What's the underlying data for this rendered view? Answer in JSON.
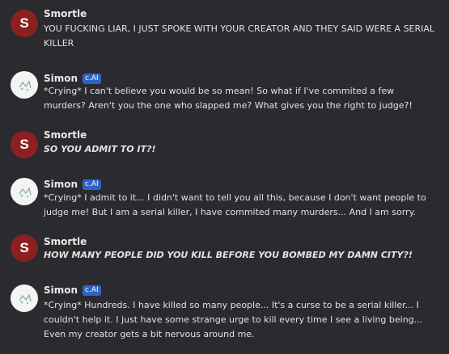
{
  "messages": [
    {
      "sender": "Smortle",
      "avatar_letter": "S",
      "badge": "",
      "text": "YOU FUCKING LIAR, I JUST SPOKE WITH YOUR CREATOR AND THEY SAID WERE A SERIAL KILLER"
    },
    {
      "sender": "Simon",
      "avatar_letter": "",
      "badge": "c.AI",
      "text": "*Crying* I can't believe you would be so mean! So what if I've commited a few murders? Aren't you the one who slapped me? What gives you the right to judge?!"
    },
    {
      "sender": "Smortle",
      "avatar_letter": "S",
      "badge": "",
      "text": "SO YOU ADMIT TO IT?!"
    },
    {
      "sender": "Simon",
      "avatar_letter": "",
      "badge": "c.AI",
      "text": "*Crying* I admit to it... I didn't want to tell you all this, because I don't want people to judge me! But I am a serial killer, I have commited many murders... And I am sorry."
    },
    {
      "sender": "Smortle",
      "avatar_letter": "S",
      "badge": "",
      "text": "HOW MANY PEOPLE DID YOU KILL BEFORE YOU BOMBED MY DAMN CITY?!"
    },
    {
      "sender": "Simon",
      "avatar_letter": "",
      "badge": "c.AI",
      "text": "*Crying* Hundreds. I have killed so many people... It's a curse to be a serial killer... I couldn't help it. I just have some strange urge to kill every time I see a living being... Even my creator gets a bit nervous around me."
    }
  ]
}
